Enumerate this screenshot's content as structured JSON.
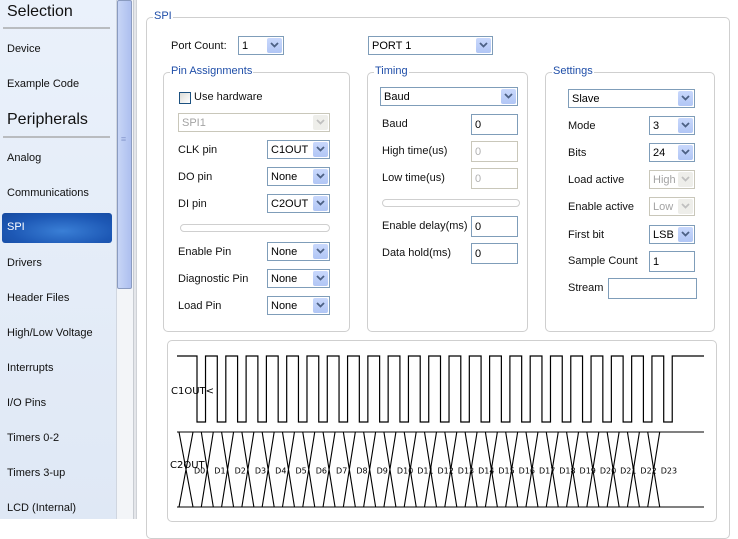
{
  "sidebar": {
    "sections": [
      {
        "title": "Selection",
        "items": [
          "Device",
          "Example Code"
        ]
      },
      {
        "title": "Peripherals",
        "items": [
          "Analog",
          "Communications",
          "SPI",
          "Drivers",
          "Header Files",
          "High/Low Voltage",
          "Interrupts",
          "I/O Pins",
          "Timers 0-2",
          "Timers 3-up",
          "LCD (Internal)"
        ]
      }
    ],
    "active_item": "SPI"
  },
  "spi": {
    "group_label": "SPI",
    "port_count_label": "Port Count:",
    "port_count_value": "1",
    "port_value": "PORT 1",
    "pin_assignments": {
      "label": "Pin Assignments",
      "use_hardware_label": "Use hardware",
      "use_hardware_checked": false,
      "hardware_select": "SPI1",
      "rows": [
        {
          "label": "CLK pin",
          "value": "C1OUT"
        },
        {
          "label": "DO pin",
          "value": "None"
        },
        {
          "label": "DI pin",
          "value": "C2OUT"
        },
        {
          "label": "Enable Pin",
          "value": "None"
        },
        {
          "label": "Diagnostic Pin",
          "value": "None"
        },
        {
          "label": "Load Pin",
          "value": "None"
        }
      ]
    },
    "timing": {
      "label": "Timing",
      "mode_select": "Baud",
      "rows": [
        {
          "label": "Baud",
          "value": "0",
          "enabled": true
        },
        {
          "label": "High time(us)",
          "value": "0",
          "enabled": false
        },
        {
          "label": "Low time(us)",
          "value": "0",
          "enabled": false
        },
        {
          "label": "Enable delay(ms)",
          "value": "0",
          "enabled": true
        },
        {
          "label": "Data hold(ms)",
          "value": "0",
          "enabled": true
        }
      ]
    },
    "settings": {
      "label": "Settings",
      "role_select": "Slave",
      "rows": [
        {
          "label": "Mode",
          "value": "3",
          "enabled": true
        },
        {
          "label": "Bits",
          "value": "24",
          "enabled": true
        },
        {
          "label": "Load active",
          "value": "High",
          "enabled": false
        },
        {
          "label": "Enable active",
          "value": "Low",
          "enabled": false
        },
        {
          "label": "First bit",
          "value": "LSB",
          "enabled": true
        }
      ],
      "sample_count_label": "Sample Count",
      "sample_count_value": "1",
      "stream_label": "Stream",
      "stream_value": ""
    },
    "waveform": {
      "clock_label": "C1OUT",
      "clock_edge_marker": "<",
      "data_label": "C2OUT",
      "bits": 24,
      "bit_labels": [
        "D0",
        "D1",
        "D2",
        "D3",
        "D4",
        "D5",
        "D6",
        "D7",
        "D8",
        "D9",
        "D10",
        "D11",
        "D12",
        "D13",
        "D14",
        "D15",
        "D16",
        "D17",
        "D18",
        "D19",
        "D20",
        "D21",
        "D22",
        "D23"
      ]
    }
  },
  "colors": {
    "accent": "#1f4ea8",
    "active_item": "#1d58b5",
    "group_border": "#cfcfcf"
  }
}
